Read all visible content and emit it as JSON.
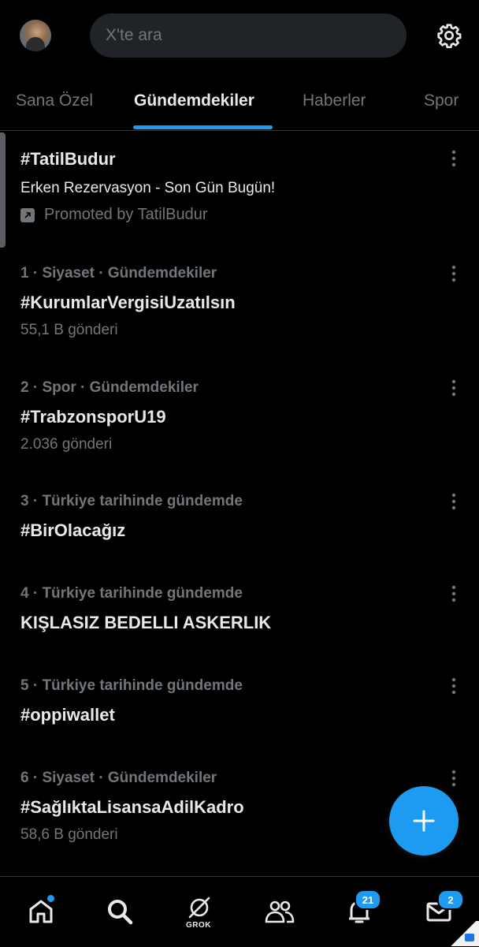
{
  "header": {
    "search_placeholder": "X'te ara",
    "avatar_icon": "avatar",
    "settings_icon": "gear-icon"
  },
  "tabs": [
    {
      "label": "Sana Özel",
      "active": false
    },
    {
      "label": "Gündemdekiler",
      "active": true
    },
    {
      "label": "Haberler",
      "active": false
    },
    {
      "label": "Spor",
      "active": false
    }
  ],
  "promoted": {
    "title": "#TatilBudur",
    "description": "Erken Rezervasyon - Son Gün Bugün!",
    "promoted_by": "Promoted by TatilBudur"
  },
  "trends": [
    {
      "meta": "1 · Siyaset · Gündemdekiler",
      "title": "#KurumlarVergisiUzatılsın",
      "count": "55,1 B gönderi"
    },
    {
      "meta": "2 · Spor · Gündemdekiler",
      "title": "#TrabzonsporU19",
      "count": "2.036 gönderi"
    },
    {
      "meta": "3 · Türkiye tarihinde gündemde",
      "title": "#BirOlacağız",
      "count": ""
    },
    {
      "meta": "4 · Türkiye tarihinde gündemde",
      "title": "KIŞLASIZ BEDELLI ASKERLIK",
      "count": ""
    },
    {
      "meta": "5 · Türkiye tarihinde gündemde",
      "title": "#oppiwallet",
      "count": ""
    },
    {
      "meta": "6 · Siyaset · Gündemdekiler",
      "title": "#SağlıktaLisansaAdilKadro",
      "count": "58,6 B gönderi"
    }
  ],
  "bottom_nav": {
    "home_icon": "home-icon",
    "search_icon": "search-icon",
    "grok_label": "GROK",
    "communities_icon": "communities-icon",
    "notifications_badge": "21",
    "messages_badge": "2"
  },
  "colors": {
    "accent": "#1d9bf0",
    "background": "#000000",
    "text_primary": "#e7e9ea",
    "text_secondary": "#71767b"
  }
}
